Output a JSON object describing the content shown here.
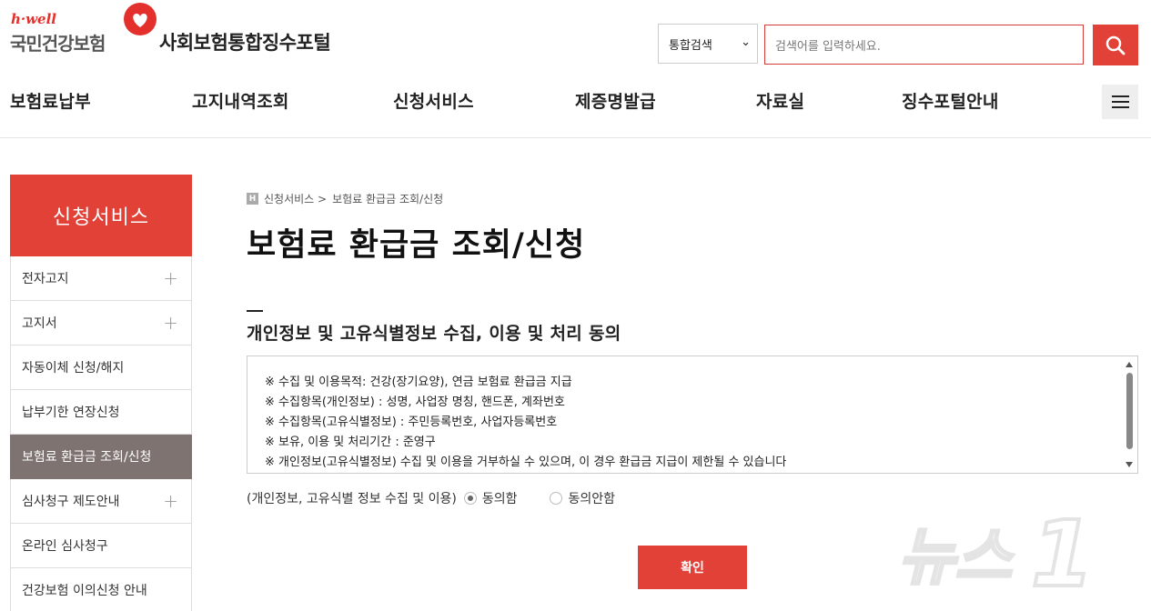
{
  "header": {
    "logo_small": "h·well",
    "logo_org": "국민건강보험",
    "portal_title": "사회보험통합징수포털",
    "search": {
      "select_value": "통합검색",
      "placeholder": "검색어를 입력하세요."
    }
  },
  "gnb": [
    "보험료납부",
    "고지내역조회",
    "신청서비스",
    "제증명발급",
    "자료실",
    "징수포털안내"
  ],
  "sidebar": {
    "title": "신청서비스",
    "items": [
      {
        "label": "전자고지",
        "expand": "+"
      },
      {
        "label": "고지서",
        "expand": "+"
      },
      {
        "label": "자동이체 신청/해지",
        "expand": ""
      },
      {
        "label": "납부기한 연장신청",
        "expand": ""
      },
      {
        "label": "보험료 환급금 조회/신청",
        "expand": "",
        "active": true
      },
      {
        "label": "심사청구 제도안내",
        "expand": "+"
      },
      {
        "label": "온라인 심사청구",
        "expand": ""
      },
      {
        "label": "건강보험 이의신청 안내",
        "expand": ""
      }
    ]
  },
  "breadcrumb": {
    "home_icon": "H",
    "level1": "신청서비스 >",
    "level2": "보험료 환급금 조회/신청"
  },
  "main": {
    "page_title": "보험료 환급금 조회/신청",
    "section_title": "개인정보 및 고유식별정보 수집, 이용 및 처리 동의",
    "consent_lines": [
      "※ 수집 및 이용목적: 건강(장기요양), 연금 보험료 환급금 지급",
      "※ 수집항목(개인정보) : 성명, 사업장 명칭, 핸드폰, 계좌번호",
      "※ 수집항목(고유식별정보) : 주민등록번호, 사업자등록번호",
      "※ 보유, 이용 및 처리기간 : 준영구",
      "※ 개인정보(고유식별정보) 수집 및 이용을 거부하실 수 있으며, 이 경우 환급금 지급이 제한될 수 있습니다"
    ],
    "agree_label": "(개인정보, 고유식별 정보 수집 및 이용)",
    "agree_option": "동의함",
    "disagree_option": "동의안함",
    "agree_selected": "동의함",
    "confirm_label": "확인"
  },
  "watermark": "뉴스1",
  "colors": {
    "accent": "#e24138",
    "active_side": "#7e7370"
  }
}
